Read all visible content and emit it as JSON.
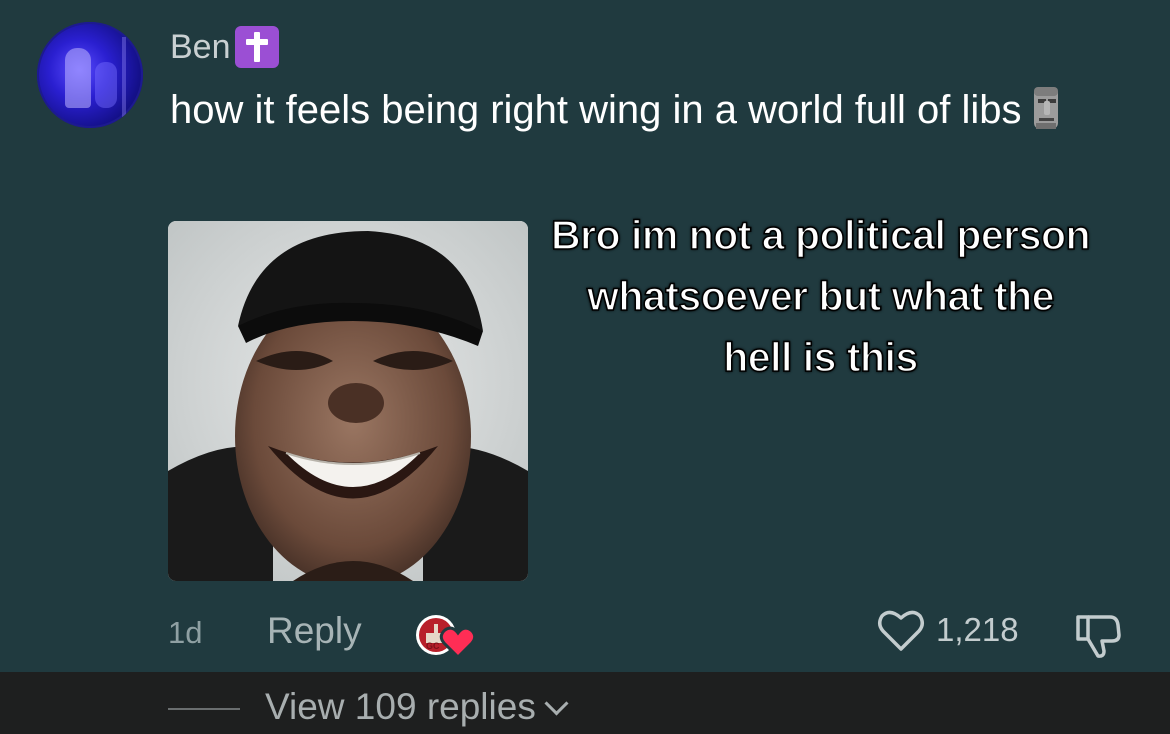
{
  "comment": {
    "username": "Ben",
    "username_badge_icon": "latin-cross-emoji",
    "text": "how it feels being right wing in a world full of libs",
    "text_emoji": "moai-emoji",
    "overlay_caption": "Bro im not a political person whatsoever but what the hell is this",
    "age": "1d",
    "reply_label": "Reply",
    "like_count": "1,218",
    "creator_liked_icon": "creator-liked-heart-icon"
  },
  "replies": {
    "label": "View 109 replies"
  },
  "colors": {
    "background": "#203a3f",
    "replies_bar": "#1e1f1f",
    "badge_purple": "#9b4fd4",
    "heart_red": "#ff2d55"
  }
}
